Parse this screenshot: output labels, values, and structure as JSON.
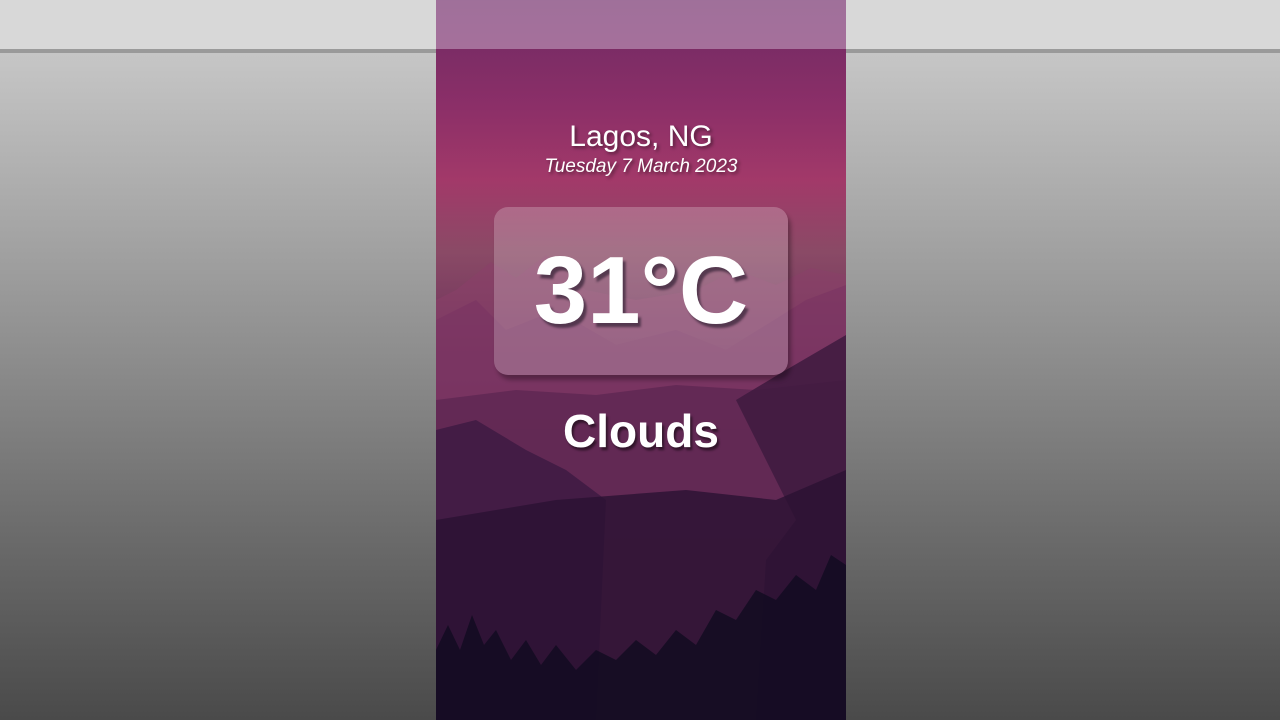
{
  "weather": {
    "location": "Lagos, NG",
    "date": "Tuesday 7 March 2023",
    "temperature": "31°C",
    "condition": "Clouds"
  },
  "colors": {
    "page_top": "#d0d0d0",
    "page_bottom": "#4a4a4a",
    "card_top": "#6e2a63",
    "card_bottom": "#120c22",
    "text": "#ffffff"
  }
}
